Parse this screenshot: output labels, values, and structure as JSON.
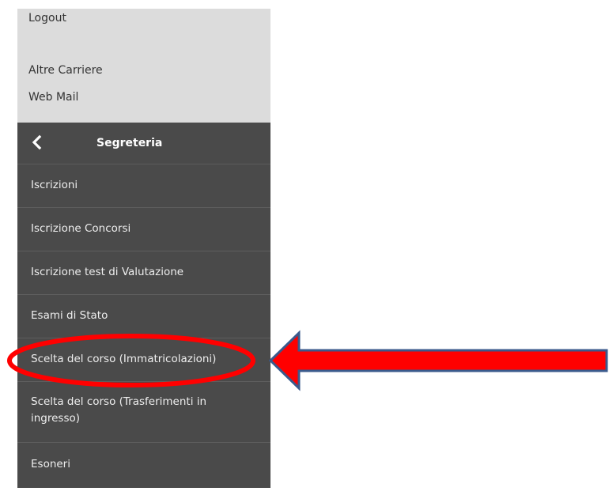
{
  "user_menu": {
    "logout": "Logout",
    "altre_carriere": "Altre Carriere",
    "web_mail": "Web Mail"
  },
  "section": {
    "title": "Segreteria",
    "back_icon": "chevron-left-icon",
    "items": [
      {
        "label": "Iscrizioni"
      },
      {
        "label": "Iscrizione Concorsi"
      },
      {
        "label": "Iscrizione test di Valutazione"
      },
      {
        "label": "Esami di Stato"
      },
      {
        "label": "Scelta del corso (Immatricolazioni)"
      },
      {
        "label": "Scelta del corso (Trasferimenti in ingresso)"
      },
      {
        "label": "Esoneri"
      }
    ]
  },
  "annotation": {
    "highlight_color": "#ff0000",
    "arrow_fill": "#ff0000",
    "arrow_outline": "#3a5a8c"
  }
}
